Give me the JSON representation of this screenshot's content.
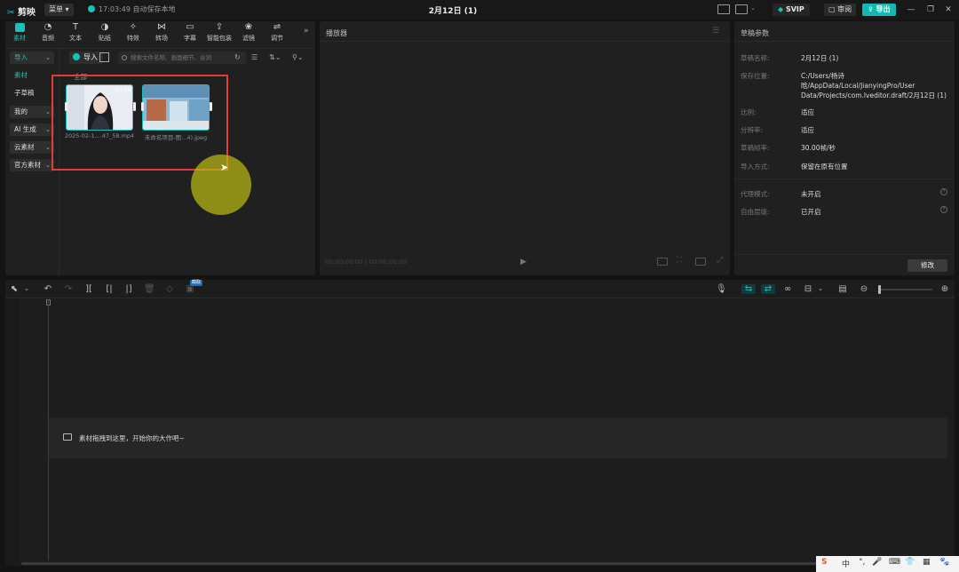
{
  "app": {
    "name": "剪映",
    "menu_label": "菜单",
    "save_time": "17:03:49",
    "save_status": "自动保存本地",
    "project_title": "2月12日 (1)"
  },
  "header": {
    "svip_label": "SVIP",
    "review_label": "审阅",
    "export_label": "导出"
  },
  "toolbar": {
    "tools": [
      {
        "label": "素材",
        "icon": "media-icon"
      },
      {
        "label": "音频",
        "icon": "audio-icon"
      },
      {
        "label": "文本",
        "icon": "text-icon"
      },
      {
        "label": "贴纸",
        "icon": "sticker-icon"
      },
      {
        "label": "特效",
        "icon": "effects-icon"
      },
      {
        "label": "转场",
        "icon": "transition-icon"
      },
      {
        "label": "字幕",
        "icon": "subtitle-icon"
      },
      {
        "label": "智能包装",
        "icon": "smart-pack-icon"
      },
      {
        "label": "滤镜",
        "icon": "filter-icon"
      },
      {
        "label": "调节",
        "icon": "adjust-icon"
      }
    ]
  },
  "sidebar": {
    "items": [
      {
        "label": "导入",
        "chev": "⌄"
      },
      {
        "label": "素材",
        "chev": ""
      },
      {
        "label": "子草稿",
        "chev": ""
      },
      {
        "label": "我的",
        "chev": "⌄"
      },
      {
        "label": "AI 生成",
        "chev": "⌄"
      },
      {
        "label": "云素材",
        "chev": "⌄"
      },
      {
        "label": "官方素材",
        "chev": "⌄"
      }
    ]
  },
  "media": {
    "import_label": "导入",
    "search_placeholder": "搜索文件名称、画面细节、台词",
    "section_label": "全部",
    "items": [
      {
        "caption": "2025-02-1....47_58.mp4",
        "duration": "00:16"
      },
      {
        "caption": "未命名项目-图...4).jpeg",
        "duration": ""
      }
    ]
  },
  "player": {
    "title": "播放器",
    "timecode": "00:00:00:00 / 00:00:00:00"
  },
  "params": {
    "title": "草稿参数",
    "rows": [
      {
        "key": "草稿名称:",
        "value": "2月12日 (1)"
      },
      {
        "key": "保存位置:",
        "value": "C:/Users/杨诗晗/AppData/Local/JianyingPro/User Data/Projects/com.lveditor.draft/2月12日 (1)"
      },
      {
        "key": "比例:",
        "value": "适应"
      },
      {
        "key": "分辨率:",
        "value": "适应"
      },
      {
        "key": "草稿帧率:",
        "value": "30.00帧/秒"
      },
      {
        "key": "导入方式:",
        "value": "保留在原有位置"
      },
      {
        "key": "代理模式:",
        "value": "未开启"
      },
      {
        "key": "自由层级:",
        "value": "已开启"
      }
    ],
    "modify_label": "修改"
  },
  "timeline": {
    "capture_badge": "截取",
    "drop_hint": "素材拖拽到这里，开始你的大作吧~"
  },
  "ime": {
    "items": [
      "S",
      "中",
      "°,",
      "🎤",
      "⌨",
      "👕",
      "▦",
      "🐾"
    ]
  },
  "colors": {
    "accent": "#19c2b8",
    "highlight_box": "#e23b3b",
    "background": "#141414",
    "panel": "#202020"
  }
}
